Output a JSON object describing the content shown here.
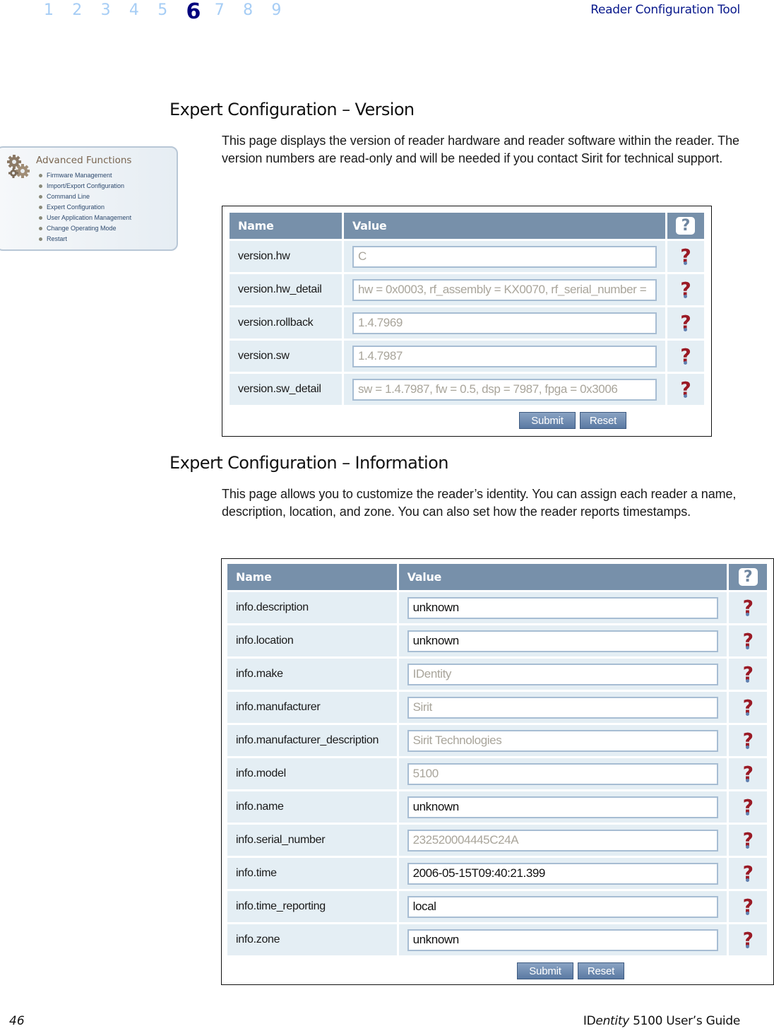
{
  "header": {
    "chapters": [
      "1",
      "2",
      "3",
      "4",
      "5",
      "6",
      "7",
      "8",
      "9"
    ],
    "current_chapter": "6",
    "title": "Reader Configuration Tool"
  },
  "advanced_functions": {
    "title": "Advanced Functions",
    "icon": "gears-icon",
    "items": [
      "Firmware Management",
      "Import/Export Configuration",
      "Command Line",
      "Expert Configuration",
      "User Application Management",
      "Change Operating Mode",
      "Restart"
    ]
  },
  "version_section": {
    "heading": "Expert Configuration – Version",
    "description": "This page displays the version of reader hardware and reader software within the reader. The version numbers are read-only and will be needed if you contact Sirit for technical support.",
    "table": {
      "columns": [
        "Name",
        "Value",
        "?"
      ],
      "rows": [
        {
          "name": "version.hw",
          "value": "C",
          "readonly": true
        },
        {
          "name": "version.hw_detail",
          "value": "hw = 0x0003, rf_assembly = KX0070, rf_serial_number =",
          "readonly": true
        },
        {
          "name": "version.rollback",
          "value": "1.4.7969",
          "readonly": true
        },
        {
          "name": "version.sw",
          "value": "1.4.7987",
          "readonly": true
        },
        {
          "name": "version.sw_detail",
          "value": "sw = 1.4.7987, fw = 0.5, dsp = 7987, fpga = 0x3006",
          "readonly": true
        }
      ]
    },
    "buttons": {
      "submit": "Submit",
      "reset": "Reset"
    }
  },
  "information_section": {
    "heading": "Expert Configuration – Information",
    "description": "This page allows you to customize the reader’s identity. You can assign each reader a name, description, location, and zone. You can also set how the reader reports timestamps.",
    "table": {
      "columns": [
        "Name",
        "Value",
        "?"
      ],
      "rows": [
        {
          "name": "info.description",
          "value": "unknown",
          "readonly": false
        },
        {
          "name": "info.location",
          "value": "unknown",
          "readonly": false
        },
        {
          "name": "info.make",
          "value": "IDentity",
          "readonly": true
        },
        {
          "name": "info.manufacturer",
          "value": "Sirit",
          "readonly": true
        },
        {
          "name": "info.manufacturer_description",
          "value": "Sirit Technologies",
          "readonly": true
        },
        {
          "name": "info.model",
          "value": "5100",
          "readonly": true
        },
        {
          "name": "info.name",
          "value": "unknown",
          "readonly": false
        },
        {
          "name": "info.serial_number",
          "value": "232520004445C24A",
          "readonly": true
        },
        {
          "name": "info.time",
          "value": "2006-05-15T09:40:21.399",
          "readonly": false
        },
        {
          "name": "info.time_reporting",
          "value": "local",
          "readonly": false
        },
        {
          "name": "info.zone",
          "value": "unknown",
          "readonly": false
        }
      ]
    },
    "buttons": {
      "submit": "Submit",
      "reset": "Reset"
    }
  },
  "footer": {
    "page_number": "46",
    "product_prefix": "ID",
    "product_italic": "entity",
    "product_suffix": " 5100 User’s Guide"
  },
  "colors": {
    "table_header": "#7790aa",
    "row_background": "#e4eef4",
    "help_icon": "#9a1a25",
    "button": "#6f8db3",
    "current_chapter": "#00007d",
    "chapter_inactive": "#a6cdf5"
  }
}
